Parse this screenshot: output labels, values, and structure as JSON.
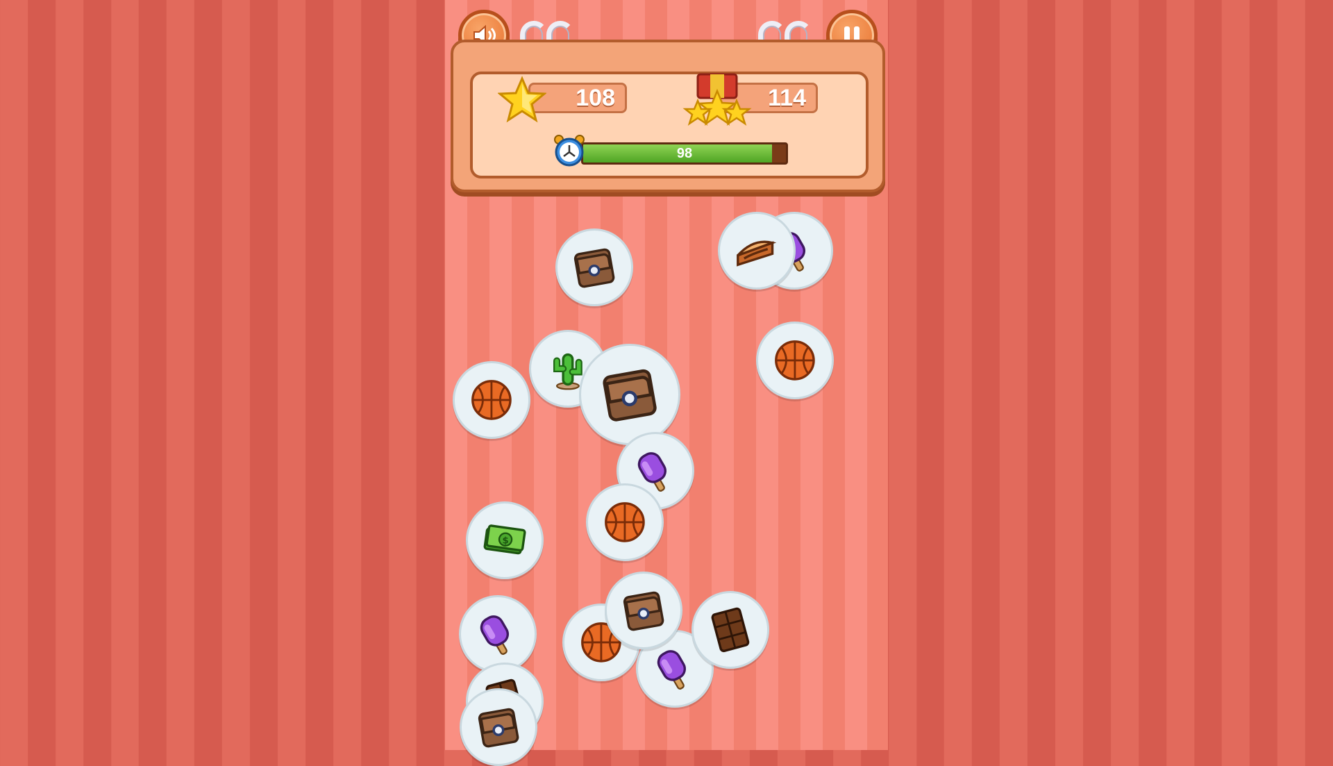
{
  "hud": {
    "score": "108",
    "target_score": "114",
    "timer_value": "98",
    "timer_fraction": 0.93
  },
  "buttons": {
    "sound_icon": "speaker-icon",
    "pause_icon": "pause-icon"
  },
  "tiles": [
    {
      "item": "wallet"
    },
    {
      "item": "popsicle"
    },
    {
      "item": "cake"
    },
    {
      "item": "cactus"
    },
    {
      "item": "basketball"
    },
    {
      "item": "wallet"
    },
    {
      "item": "basketball"
    },
    {
      "item": "popsicle"
    },
    {
      "item": "basketball"
    },
    {
      "item": "cash"
    },
    {
      "item": "popsicle"
    },
    {
      "item": "basketball"
    },
    {
      "item": "popsicle"
    },
    {
      "item": "wallet"
    },
    {
      "item": "chocolate"
    },
    {
      "item": "chocolate"
    },
    {
      "item": "wallet"
    }
  ],
  "colors": {
    "accent": "#e8722f",
    "timer_green": "#5db52e",
    "board": "#f98f82"
  }
}
